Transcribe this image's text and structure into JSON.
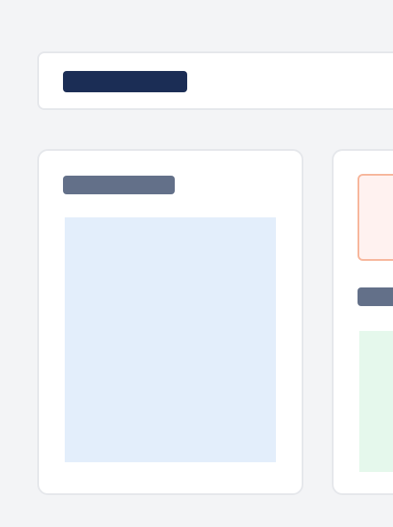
{
  "colors": {
    "background": "#f3f4f6",
    "surface": "#ffffff",
    "border": "#e5e7eb",
    "title_bar": "#1b2d55",
    "section_bar": "#637089",
    "blue_panel": "#e3eefb",
    "alert_fill": "#fff2f0",
    "alert_border": "#f7b59a",
    "green_panel": "#e5f8ec"
  },
  "header": {
    "title": ""
  },
  "cards": [
    {
      "section_label": ""
    },
    {
      "alert_text": "",
      "section_label": ""
    }
  ]
}
